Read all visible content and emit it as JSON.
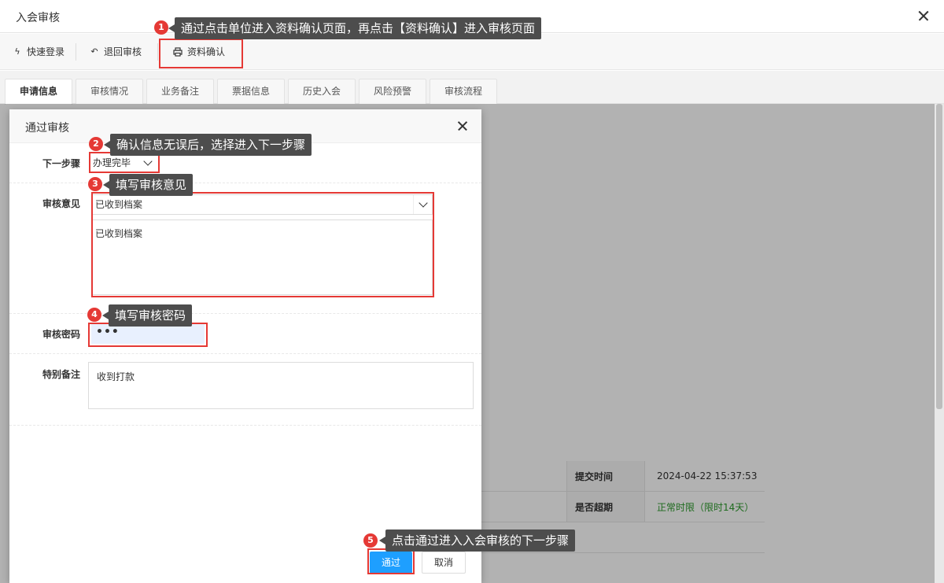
{
  "window": {
    "title": "入会审核",
    "close_icon": "close-icon"
  },
  "toolbar": {
    "quick_login": "快速登录",
    "return_review": "退回审核",
    "data_confirm": "资料确认"
  },
  "tabs": [
    {
      "label": "申请信息",
      "active": true
    },
    {
      "label": "审核情况"
    },
    {
      "label": "业务备注"
    },
    {
      "label": "票据信息"
    },
    {
      "label": "历史入会"
    },
    {
      "label": "风险预警"
    },
    {
      "label": "审核流程"
    }
  ],
  "background_table": {
    "rows": [
      {
        "key": "提交时间",
        "value": "2024-04-22 15:37:53"
      },
      {
        "key": "是否超期",
        "value": "正常时限（限时14天）"
      }
    ]
  },
  "modal": {
    "title": "通过审核",
    "next_step_label": "下一步骤",
    "next_step_value": "办理完毕",
    "opinion_label": "审核意见",
    "opinion_select_value": "已收到档案",
    "opinion_text": "已收到档案",
    "password_label": "审核密码",
    "password_value": "•••",
    "remark_label": "特别备注",
    "remark_value": "收到打款",
    "pass_button": "通过",
    "cancel_button": "取消"
  },
  "annotations": [
    {
      "num": "1",
      "text": "通过点击单位进入资料确认页面，再点击【资料确认】进入审核页面"
    },
    {
      "num": "2",
      "text": "确认信息无误后，选择进入下一步骤"
    },
    {
      "num": "3",
      "text": "填写审核意见"
    },
    {
      "num": "4",
      "text": "填写审核密码"
    },
    {
      "num": "5",
      "text": "点击通过进入入会审核的下一步骤"
    }
  ],
  "colors": {
    "accent": "#1e9fff",
    "annotation_red": "#e53935",
    "callout_bg": "#4d4d4d",
    "ok_green": "#2c9a2c"
  }
}
